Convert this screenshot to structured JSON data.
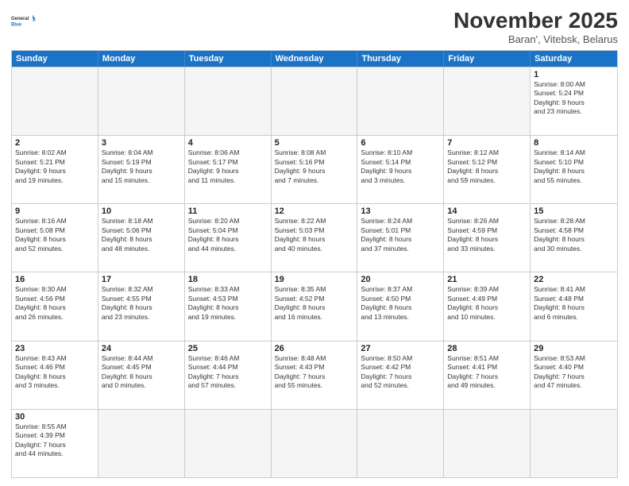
{
  "logo": {
    "general": "General",
    "blue": "Blue"
  },
  "title": {
    "month": "November 2025",
    "location": "Baran', Vitebsk, Belarus"
  },
  "header_days": [
    "Sunday",
    "Monday",
    "Tuesday",
    "Wednesday",
    "Thursday",
    "Friday",
    "Saturday"
  ],
  "weeks": [
    [
      {
        "day": "",
        "info": ""
      },
      {
        "day": "",
        "info": ""
      },
      {
        "day": "",
        "info": ""
      },
      {
        "day": "",
        "info": ""
      },
      {
        "day": "",
        "info": ""
      },
      {
        "day": "",
        "info": ""
      },
      {
        "day": "1",
        "info": "Sunrise: 8:00 AM\nSunset: 5:24 PM\nDaylight: 9 hours\nand 23 minutes."
      }
    ],
    [
      {
        "day": "2",
        "info": "Sunrise: 8:02 AM\nSunset: 5:21 PM\nDaylight: 9 hours\nand 19 minutes."
      },
      {
        "day": "3",
        "info": "Sunrise: 8:04 AM\nSunset: 5:19 PM\nDaylight: 9 hours\nand 15 minutes."
      },
      {
        "day": "4",
        "info": "Sunrise: 8:06 AM\nSunset: 5:17 PM\nDaylight: 9 hours\nand 11 minutes."
      },
      {
        "day": "5",
        "info": "Sunrise: 8:08 AM\nSunset: 5:16 PM\nDaylight: 9 hours\nand 7 minutes."
      },
      {
        "day": "6",
        "info": "Sunrise: 8:10 AM\nSunset: 5:14 PM\nDaylight: 9 hours\nand 3 minutes."
      },
      {
        "day": "7",
        "info": "Sunrise: 8:12 AM\nSunset: 5:12 PM\nDaylight: 8 hours\nand 59 minutes."
      },
      {
        "day": "8",
        "info": "Sunrise: 8:14 AM\nSunset: 5:10 PM\nDaylight: 8 hours\nand 55 minutes."
      }
    ],
    [
      {
        "day": "9",
        "info": "Sunrise: 8:16 AM\nSunset: 5:08 PM\nDaylight: 8 hours\nand 52 minutes."
      },
      {
        "day": "10",
        "info": "Sunrise: 8:18 AM\nSunset: 5:06 PM\nDaylight: 8 hours\nand 48 minutes."
      },
      {
        "day": "11",
        "info": "Sunrise: 8:20 AM\nSunset: 5:04 PM\nDaylight: 8 hours\nand 44 minutes."
      },
      {
        "day": "12",
        "info": "Sunrise: 8:22 AM\nSunset: 5:03 PM\nDaylight: 8 hours\nand 40 minutes."
      },
      {
        "day": "13",
        "info": "Sunrise: 8:24 AM\nSunset: 5:01 PM\nDaylight: 8 hours\nand 37 minutes."
      },
      {
        "day": "14",
        "info": "Sunrise: 8:26 AM\nSunset: 4:59 PM\nDaylight: 8 hours\nand 33 minutes."
      },
      {
        "day": "15",
        "info": "Sunrise: 8:28 AM\nSunset: 4:58 PM\nDaylight: 8 hours\nand 30 minutes."
      }
    ],
    [
      {
        "day": "16",
        "info": "Sunrise: 8:30 AM\nSunset: 4:56 PM\nDaylight: 8 hours\nand 26 minutes."
      },
      {
        "day": "17",
        "info": "Sunrise: 8:32 AM\nSunset: 4:55 PM\nDaylight: 8 hours\nand 23 minutes."
      },
      {
        "day": "18",
        "info": "Sunrise: 8:33 AM\nSunset: 4:53 PM\nDaylight: 8 hours\nand 19 minutes."
      },
      {
        "day": "19",
        "info": "Sunrise: 8:35 AM\nSunset: 4:52 PM\nDaylight: 8 hours\nand 16 minutes."
      },
      {
        "day": "20",
        "info": "Sunrise: 8:37 AM\nSunset: 4:50 PM\nDaylight: 8 hours\nand 13 minutes."
      },
      {
        "day": "21",
        "info": "Sunrise: 8:39 AM\nSunset: 4:49 PM\nDaylight: 8 hours\nand 10 minutes."
      },
      {
        "day": "22",
        "info": "Sunrise: 8:41 AM\nSunset: 4:48 PM\nDaylight: 8 hours\nand 6 minutes."
      }
    ],
    [
      {
        "day": "23",
        "info": "Sunrise: 8:43 AM\nSunset: 4:46 PM\nDaylight: 8 hours\nand 3 minutes."
      },
      {
        "day": "24",
        "info": "Sunrise: 8:44 AM\nSunset: 4:45 PM\nDaylight: 8 hours\nand 0 minutes."
      },
      {
        "day": "25",
        "info": "Sunrise: 8:46 AM\nSunset: 4:44 PM\nDaylight: 7 hours\nand 57 minutes."
      },
      {
        "day": "26",
        "info": "Sunrise: 8:48 AM\nSunset: 4:43 PM\nDaylight: 7 hours\nand 55 minutes."
      },
      {
        "day": "27",
        "info": "Sunrise: 8:50 AM\nSunset: 4:42 PM\nDaylight: 7 hours\nand 52 minutes."
      },
      {
        "day": "28",
        "info": "Sunrise: 8:51 AM\nSunset: 4:41 PM\nDaylight: 7 hours\nand 49 minutes."
      },
      {
        "day": "29",
        "info": "Sunrise: 8:53 AM\nSunset: 4:40 PM\nDaylight: 7 hours\nand 47 minutes."
      }
    ],
    [
      {
        "day": "30",
        "info": "Sunrise: 8:55 AM\nSunset: 4:39 PM\nDaylight: 7 hours\nand 44 minutes."
      },
      {
        "day": "",
        "info": ""
      },
      {
        "day": "",
        "info": ""
      },
      {
        "day": "",
        "info": ""
      },
      {
        "day": "",
        "info": ""
      },
      {
        "day": "",
        "info": ""
      },
      {
        "day": "",
        "info": ""
      }
    ]
  ]
}
